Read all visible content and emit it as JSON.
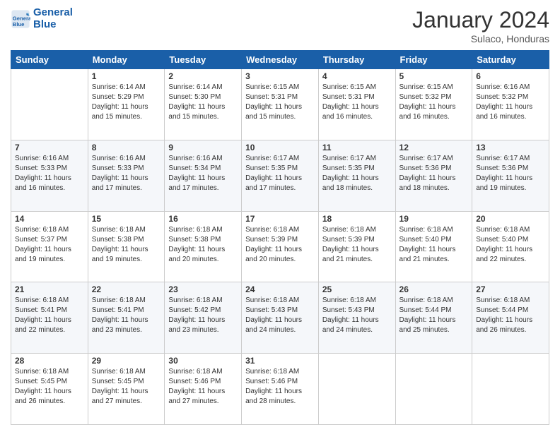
{
  "logo": {
    "line1": "General",
    "line2": "Blue"
  },
  "title": "January 2024",
  "subtitle": "Sulaco, Honduras",
  "weekdays": [
    "Sunday",
    "Monday",
    "Tuesday",
    "Wednesday",
    "Thursday",
    "Friday",
    "Saturday"
  ],
  "weeks": [
    [
      {
        "day": "",
        "info": ""
      },
      {
        "day": "1",
        "info": "Sunrise: 6:14 AM\nSunset: 5:29 PM\nDaylight: 11 hours\nand 15 minutes."
      },
      {
        "day": "2",
        "info": "Sunrise: 6:14 AM\nSunset: 5:30 PM\nDaylight: 11 hours\nand 15 minutes."
      },
      {
        "day": "3",
        "info": "Sunrise: 6:15 AM\nSunset: 5:31 PM\nDaylight: 11 hours\nand 15 minutes."
      },
      {
        "day": "4",
        "info": "Sunrise: 6:15 AM\nSunset: 5:31 PM\nDaylight: 11 hours\nand 16 minutes."
      },
      {
        "day": "5",
        "info": "Sunrise: 6:15 AM\nSunset: 5:32 PM\nDaylight: 11 hours\nand 16 minutes."
      },
      {
        "day": "6",
        "info": "Sunrise: 6:16 AM\nSunset: 5:32 PM\nDaylight: 11 hours\nand 16 minutes."
      }
    ],
    [
      {
        "day": "7",
        "info": "Sunrise: 6:16 AM\nSunset: 5:33 PM\nDaylight: 11 hours\nand 16 minutes."
      },
      {
        "day": "8",
        "info": "Sunrise: 6:16 AM\nSunset: 5:33 PM\nDaylight: 11 hours\nand 17 minutes."
      },
      {
        "day": "9",
        "info": "Sunrise: 6:16 AM\nSunset: 5:34 PM\nDaylight: 11 hours\nand 17 minutes."
      },
      {
        "day": "10",
        "info": "Sunrise: 6:17 AM\nSunset: 5:35 PM\nDaylight: 11 hours\nand 17 minutes."
      },
      {
        "day": "11",
        "info": "Sunrise: 6:17 AM\nSunset: 5:35 PM\nDaylight: 11 hours\nand 18 minutes."
      },
      {
        "day": "12",
        "info": "Sunrise: 6:17 AM\nSunset: 5:36 PM\nDaylight: 11 hours\nand 18 minutes."
      },
      {
        "day": "13",
        "info": "Sunrise: 6:17 AM\nSunset: 5:36 PM\nDaylight: 11 hours\nand 19 minutes."
      }
    ],
    [
      {
        "day": "14",
        "info": "Sunrise: 6:18 AM\nSunset: 5:37 PM\nDaylight: 11 hours\nand 19 minutes."
      },
      {
        "day": "15",
        "info": "Sunrise: 6:18 AM\nSunset: 5:38 PM\nDaylight: 11 hours\nand 19 minutes."
      },
      {
        "day": "16",
        "info": "Sunrise: 6:18 AM\nSunset: 5:38 PM\nDaylight: 11 hours\nand 20 minutes."
      },
      {
        "day": "17",
        "info": "Sunrise: 6:18 AM\nSunset: 5:39 PM\nDaylight: 11 hours\nand 20 minutes."
      },
      {
        "day": "18",
        "info": "Sunrise: 6:18 AM\nSunset: 5:39 PM\nDaylight: 11 hours\nand 21 minutes."
      },
      {
        "day": "19",
        "info": "Sunrise: 6:18 AM\nSunset: 5:40 PM\nDaylight: 11 hours\nand 21 minutes."
      },
      {
        "day": "20",
        "info": "Sunrise: 6:18 AM\nSunset: 5:40 PM\nDaylight: 11 hours\nand 22 minutes."
      }
    ],
    [
      {
        "day": "21",
        "info": "Sunrise: 6:18 AM\nSunset: 5:41 PM\nDaylight: 11 hours\nand 22 minutes."
      },
      {
        "day": "22",
        "info": "Sunrise: 6:18 AM\nSunset: 5:41 PM\nDaylight: 11 hours\nand 23 minutes."
      },
      {
        "day": "23",
        "info": "Sunrise: 6:18 AM\nSunset: 5:42 PM\nDaylight: 11 hours\nand 23 minutes."
      },
      {
        "day": "24",
        "info": "Sunrise: 6:18 AM\nSunset: 5:43 PM\nDaylight: 11 hours\nand 24 minutes."
      },
      {
        "day": "25",
        "info": "Sunrise: 6:18 AM\nSunset: 5:43 PM\nDaylight: 11 hours\nand 24 minutes."
      },
      {
        "day": "26",
        "info": "Sunrise: 6:18 AM\nSunset: 5:44 PM\nDaylight: 11 hours\nand 25 minutes."
      },
      {
        "day": "27",
        "info": "Sunrise: 6:18 AM\nSunset: 5:44 PM\nDaylight: 11 hours\nand 26 minutes."
      }
    ],
    [
      {
        "day": "28",
        "info": "Sunrise: 6:18 AM\nSunset: 5:45 PM\nDaylight: 11 hours\nand 26 minutes."
      },
      {
        "day": "29",
        "info": "Sunrise: 6:18 AM\nSunset: 5:45 PM\nDaylight: 11 hours\nand 27 minutes."
      },
      {
        "day": "30",
        "info": "Sunrise: 6:18 AM\nSunset: 5:46 PM\nDaylight: 11 hours\nand 27 minutes."
      },
      {
        "day": "31",
        "info": "Sunrise: 6:18 AM\nSunset: 5:46 PM\nDaylight: 11 hours\nand 28 minutes."
      },
      {
        "day": "",
        "info": ""
      },
      {
        "day": "",
        "info": ""
      },
      {
        "day": "",
        "info": ""
      }
    ]
  ]
}
